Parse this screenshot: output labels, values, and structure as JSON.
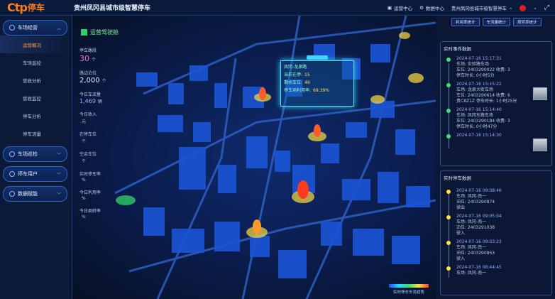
{
  "header": {
    "logo_mark": "Ctp",
    "logo_text": "停车",
    "title": "贵州凤冈县城市级智慧停车",
    "actions": [
      {
        "label": "运营中心"
      },
      {
        "label": "数据中心"
      },
      {
        "label": "贵州凤冈县城市级智慧停车"
      }
    ],
    "flag_color": "#e21d1d"
  },
  "sidebar": {
    "sections": [
      {
        "label": "车场经营",
        "items": [
          "运营概况",
          "车场监控",
          "营收分析",
          "营收监控",
          "停车分析",
          "停车流量"
        ],
        "active_index": 0
      },
      {
        "label": "车场巡检",
        "items": []
      },
      {
        "label": "停车用户",
        "items": []
      },
      {
        "label": "数据赋能",
        "items": []
      }
    ]
  },
  "map": {
    "title": "运营驾驶舱",
    "kpis": [
      {
        "label": "停车路段",
        "value": "30",
        "unit": "个"
      },
      {
        "label": "路边泊位",
        "value": "2,000",
        "unit": "个"
      },
      {
        "label": "今日车流量",
        "value": "1,469",
        "unit": "辆"
      },
      {
        "label": "今日收入",
        "value": "",
        "unit": "元"
      },
      {
        "label": "在停车位",
        "value": "",
        "unit": "个"
      },
      {
        "label": "空余车位",
        "value": "",
        "unit": "个"
      },
      {
        "label": "实时停车率",
        "value": "",
        "unit": "%"
      },
      {
        "label": "今日利用率",
        "value": "",
        "unit": "%"
      },
      {
        "label": "今日周转率",
        "value": "",
        "unit": "%"
      }
    ],
    "popup": {
      "name": "凤冈-龙泉路",
      "rows": [
        {
          "label": "当前在停:",
          "value": "15"
        },
        {
          "label": "剩余车位:",
          "value": "49"
        },
        {
          "label": "停车场利用率:",
          "value": "69.39%"
        }
      ]
    },
    "legend_label": "实时停车车流趋势"
  },
  "right_panel": {
    "tabs": [
      "利用率统计",
      "车流量统计",
      "周转率统计"
    ],
    "events_title": "实时事件数据",
    "events": [
      {
        "time": "2024-07-16 15:17:31",
        "lines": [
          "车场: 实验路车场",
          "车位: 2403290022  收费: 3",
          "停车时长: 0小时5分"
        ],
        "color": "#3ee07a"
      },
      {
        "time": "2024-07-16 15:15:22",
        "lines": [
          "车场: 龙泉大街车场",
          "车位: 2403290614  收费: 6",
          "贵C8Z1Z  停车时长: 1小时25分"
        ],
        "color": "#3ee07a"
      },
      {
        "time": "2024-07-16 15:14:40",
        "lines": [
          "车场: 凤冈东路车场",
          "车位: 2403290184  收费: 3",
          "停车时长: 0小时47分"
        ],
        "color": "#3ee07a"
      },
      {
        "time": "2024-07-16 15:14:30",
        "lines": [],
        "color": "#3ee07a"
      }
    ],
    "parking_title": "实时停车数据",
    "parking": [
      {
        "time": "2024-07-16 09:08:46",
        "lines": [
          "车场: 凤冈-南一",
          "泊位: 2403290874",
          "驶出"
        ],
        "color": "#ffe23a"
      },
      {
        "time": "2024-07-16 09:05:04",
        "lines": [
          "车场: 凤冈-南一",
          "泊位: 2403291038",
          "驶入"
        ],
        "color": "#ffe23a"
      },
      {
        "time": "2024-07-16 09:03:23",
        "lines": [
          "车场: 凤冈-南一",
          "泊位: 2403290853",
          "驶入"
        ],
        "color": "#ffe23a"
      },
      {
        "time": "2024-07-16 08:44:45",
        "lines": [
          "车场: 凤冈-南一"
        ],
        "color": "#ffe23a"
      }
    ]
  },
  "colors": {
    "accent_orange": "#ff7a1a",
    "cyan": "#3dd6ff",
    "green": "#3ee07a"
  }
}
